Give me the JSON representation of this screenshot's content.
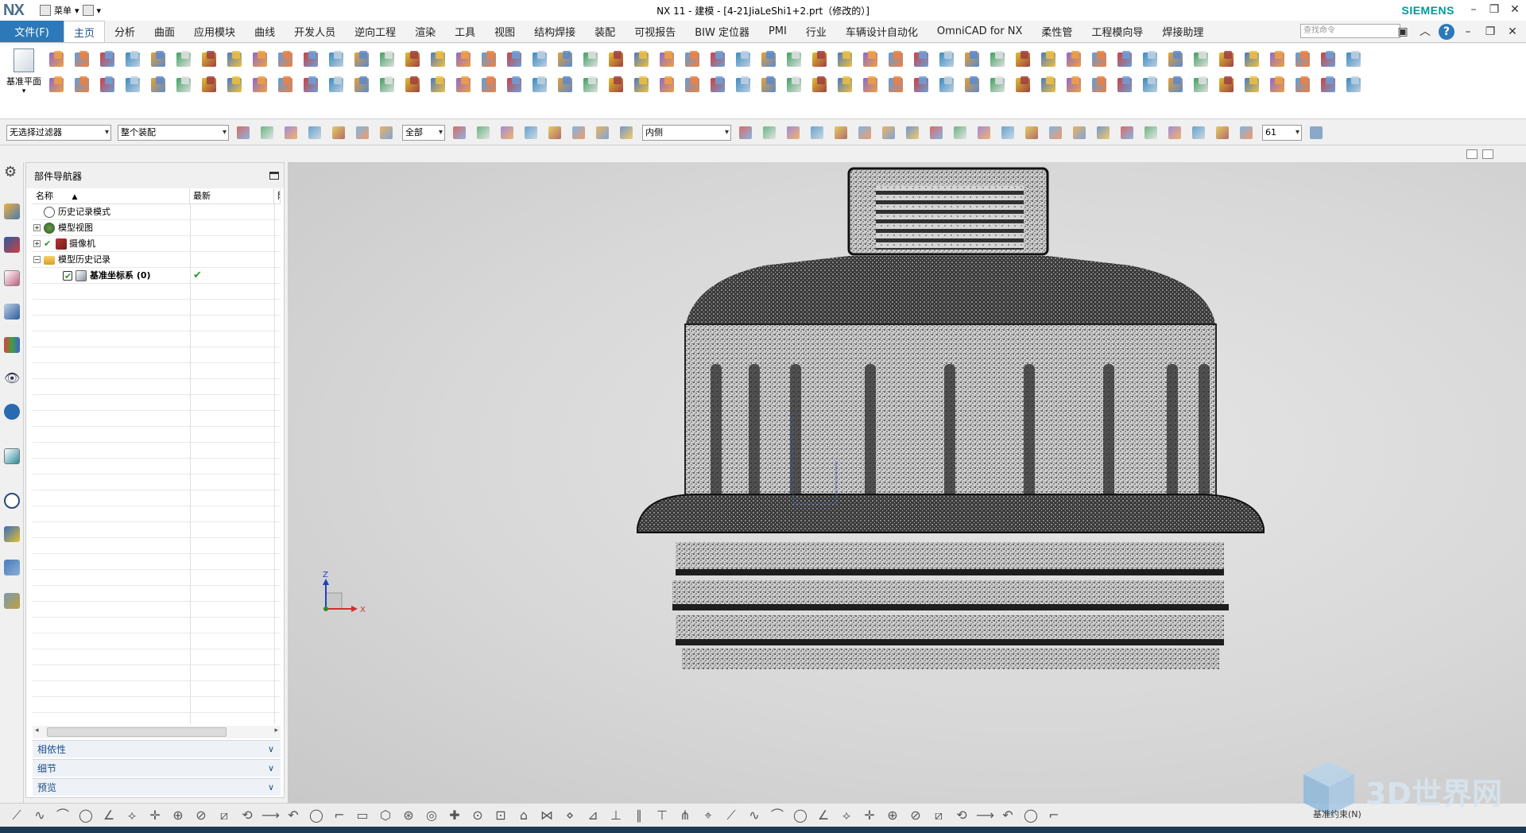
{
  "titlebar": {
    "logo": "NX",
    "menu_label": "菜单",
    "window_title": "NX 11 - 建模 - [4-21JiaLeShi1+2.prt（修改的）]",
    "brand": "SIEMENS"
  },
  "tabs": {
    "file": "文件(F)",
    "items": [
      "主页",
      "分析",
      "曲面",
      "应用模块",
      "曲线",
      "开发人员",
      "逆向工程",
      "渲染",
      "工具",
      "视图",
      "结构焊接",
      "装配",
      "可视报告",
      "BIW 定位器",
      "PMI",
      "行业",
      "车辆设计自动化",
      "OmniCAD for NX",
      "柔性管",
      "工程模向导",
      "焊接助理"
    ],
    "search_placeholder": "查找命令"
  },
  "ribbon": {
    "datum_plane_label": "基准平面"
  },
  "selection_bar": {
    "filter": "无选择过滤器",
    "scope": "整个装配",
    "all": "全部",
    "inner": "内侧",
    "zoom": "61"
  },
  "navigator": {
    "title": "部件导航器",
    "columns": [
      "名称",
      "最新",
      "附"
    ],
    "rows": [
      {
        "label": "历史记录模式",
        "icon": "clock-icon"
      },
      {
        "label": "模型视图",
        "icon": "views-icon"
      },
      {
        "label": "摄像机",
        "icon": "camera-icon"
      },
      {
        "label": "模型历史记录",
        "icon": "folder-icon"
      },
      {
        "label": "基准坐标系 (0)",
        "icon": "datum-csys-icon",
        "up_to_date": "✔"
      }
    ],
    "panels": [
      "相依性",
      "细节",
      "预览"
    ]
  },
  "viewport": {
    "axis_z": "Z",
    "axis_x": "X",
    "label": "3D point cloud scan of threaded bottle cap"
  },
  "bottom_bar": {
    "status_text": "基准约束(N)"
  },
  "watermark": {
    "text": "3D世界网"
  },
  "colors": {
    "file_tab": "#2c78b9",
    "accent": "#1a4f8a",
    "brand": "#009999",
    "viewport_bg": "#d8d8d8"
  }
}
